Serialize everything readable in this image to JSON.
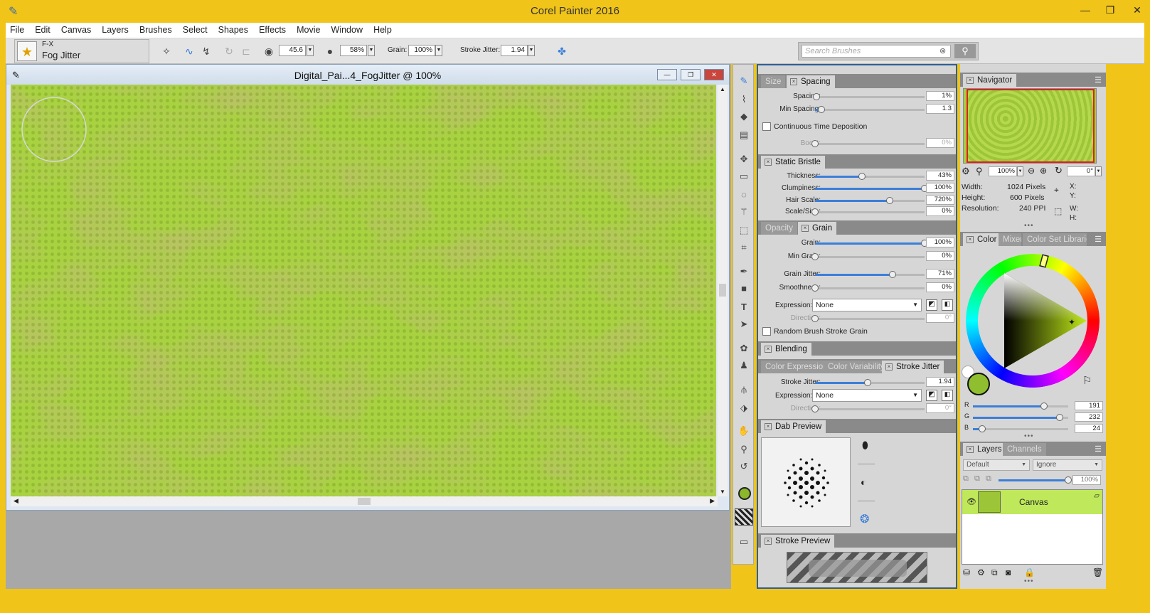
{
  "app": {
    "title": "Corel Painter 2016"
  },
  "menu": [
    "File",
    "Edit",
    "Canvas",
    "Layers",
    "Brushes",
    "Select",
    "Shapes",
    "Effects",
    "Movie",
    "Window",
    "Help"
  ],
  "brush": {
    "category": "F-X",
    "variant": "Fog Jitter"
  },
  "propbar": {
    "size_value": "45.6",
    "opacity_value": "58%",
    "grain_label": "Grain:",
    "grain_value": "100%",
    "jitter_label": "Stroke Jitter:",
    "jitter_value": "1.94"
  },
  "search": {
    "placeholder": "Search Brushes"
  },
  "document": {
    "title": "Digital_Pai...4_FogJitter @ 100%"
  },
  "panels": {
    "spacing": {
      "tabs": [
        "Size",
        "Spacing"
      ],
      "rows": [
        {
          "label": "Spacing:",
          "value": "1%",
          "fraction": 0.01
        },
        {
          "label": "Min Spacing:",
          "value": "1.3",
          "fraction": 0.06
        }
      ],
      "checkbox": "Continuous Time Deposition",
      "boost": {
        "label": "Boost:",
        "value": "0%",
        "fraction": 0
      }
    },
    "bristle": {
      "tab": "Static Bristle",
      "rows": [
        {
          "label": "Thickness:",
          "value": "43%",
          "fraction": 0.43
        },
        {
          "label": "Clumpiness:",
          "value": "100%",
          "fraction": 1.0
        },
        {
          "label": "Hair Scale:",
          "value": "720%",
          "fraction": 0.68
        },
        {
          "label": "Scale/Size:",
          "value": "0%",
          "fraction": 0
        }
      ]
    },
    "grain": {
      "tabs": [
        "Opacity",
        "Grain"
      ],
      "rows": [
        {
          "label": "Grain:",
          "value": "100%",
          "fraction": 1.0
        },
        {
          "label": "Min Grain:",
          "value": "0%",
          "fraction": 0
        },
        {
          "label": "Grain Jitter:",
          "value": "71%",
          "fraction": 0.71
        },
        {
          "label": "Smoothness:",
          "value": "0%",
          "fraction": 0
        }
      ],
      "expression_label": "Expression:",
      "expression_value": "None",
      "direction": {
        "label": "Direction:",
        "value": "0°",
        "fraction": 0
      },
      "checkbox": "Random Brush Stroke Grain"
    },
    "blending": {
      "tab": "Blending"
    },
    "jitter": {
      "tabs": [
        "Color Expression",
        "Color Variability",
        "Stroke Jitter"
      ],
      "row": {
        "label": "Stroke Jitter:",
        "value": "1.94",
        "fraction": 0.48
      },
      "expression_label": "Expression:",
      "expression_value": "None",
      "direction": {
        "label": "Direction:",
        "value": "0°",
        "fraction": 0
      }
    },
    "dab": {
      "tab": "Dab Preview"
    },
    "stroke": {
      "tab": "Stroke Preview"
    }
  },
  "navigator": {
    "tab": "Navigator",
    "zoom": "100%",
    "rotation": "0°",
    "width_label": "Width:",
    "width_value": "1024 Pixels",
    "height_label": "Height:",
    "height_value": "600 Pixels",
    "res_label": "Resolution:",
    "res_value": "240 PPI",
    "x_label": "X:",
    "y_label": "Y:",
    "w_label": "W:",
    "h_label": "H:"
  },
  "color": {
    "tabs": [
      "Color",
      "Mixer",
      "Color Set Libraries"
    ],
    "r": {
      "label": "R",
      "value": "191",
      "fraction": 0.749
    },
    "g": {
      "label": "G",
      "value": "232",
      "fraction": 0.91
    },
    "b": {
      "label": "B",
      "value": "24",
      "fraction": 0.094
    },
    "current_hex": "#bfe818"
  },
  "layers": {
    "tabs": [
      "Layers",
      "Channels"
    ],
    "composite": "Default",
    "depth": "Ignore",
    "opacity": "100%",
    "opacity_fraction": 1.0,
    "items": [
      {
        "name": "Canvas"
      }
    ]
  },
  "colors": {
    "accent": "#3b7ed8",
    "frame": "#f0c419",
    "panel_border": "#2f5e95"
  }
}
